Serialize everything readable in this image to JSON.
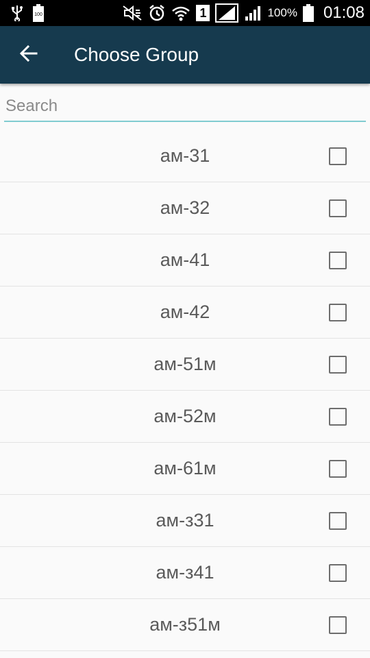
{
  "status_bar": {
    "battery_percent": "100%",
    "clock": "01:08",
    "sim_number": "1",
    "icons": [
      "usb-icon",
      "battery-small-icon",
      "mute-icon",
      "alarm-icon",
      "wifi-icon",
      "sim-icon",
      "signal-icon",
      "signal-icon",
      "battery-icon"
    ]
  },
  "appbar": {
    "title": "Choose Group",
    "back_icon": "arrow-left-icon",
    "background": "#163a4e"
  },
  "search": {
    "placeholder": "Search",
    "value": "",
    "underline_color": "#80cbd0"
  },
  "groups": [
    {
      "label": "ам-31",
      "checked": false
    },
    {
      "label": "ам-32",
      "checked": false
    },
    {
      "label": "ам-41",
      "checked": false
    },
    {
      "label": "ам-42",
      "checked": false
    },
    {
      "label": "ам-51м",
      "checked": false
    },
    {
      "label": "ам-52м",
      "checked": false
    },
    {
      "label": "ам-61м",
      "checked": false
    },
    {
      "label": "ам-з31",
      "checked": false
    },
    {
      "label": "ам-з41",
      "checked": false
    },
    {
      "label": "ам-з51м",
      "checked": false
    }
  ]
}
